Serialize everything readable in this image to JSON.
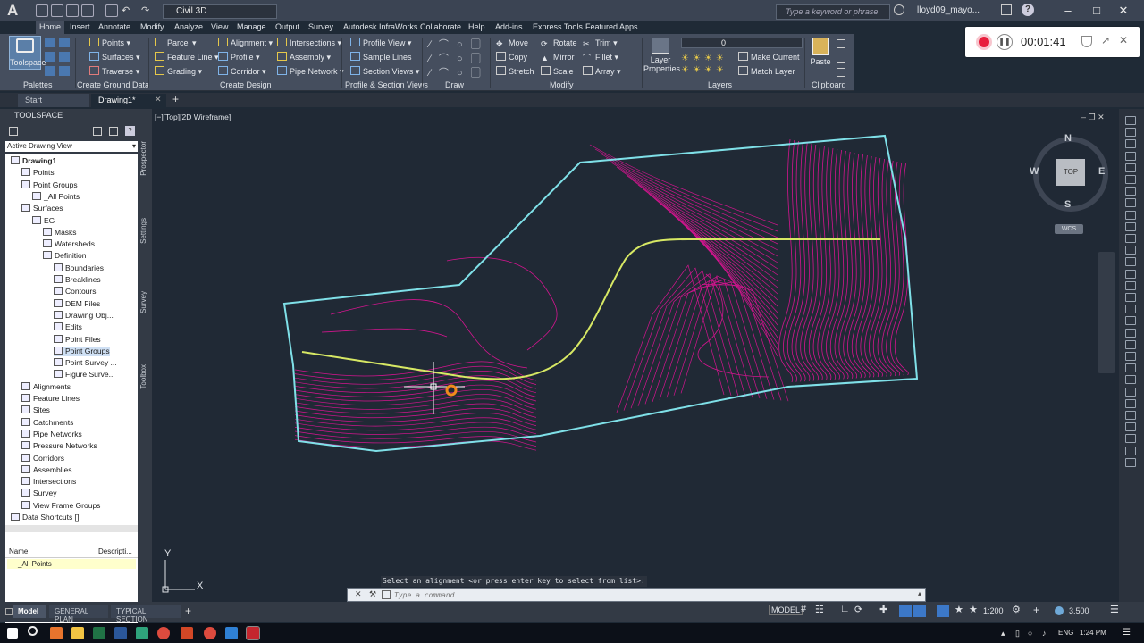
{
  "app": {
    "logo_letter": "A",
    "workspace": "Civil 3D",
    "search_placeholder": "Type a keyword or phrase",
    "user": "lloyd09_mayo...",
    "help": "?"
  },
  "ribbon_tabs": [
    "Home",
    "Insert",
    "Annotate",
    "Modify",
    "Analyze",
    "View",
    "Manage",
    "Output",
    "Survey",
    "Autodesk InfraWorks",
    "Collaborate",
    "Help",
    "Add-ins",
    "Express Tools",
    "Featured Apps"
  ],
  "ribbon": {
    "toolspace_label": "Toolspace",
    "palettes_title": "Palettes",
    "ground_data": {
      "title": "Create Ground Data",
      "items": [
        "Points",
        "Surfaces",
        "Traverse"
      ]
    },
    "design": {
      "title": "Create Design",
      "items": [
        "Parcel",
        "Feature Line",
        "Grading",
        "Alignment",
        "Profile",
        "Corridor",
        "Intersections",
        "Assembly",
        "Pipe Network"
      ]
    },
    "profile_section": {
      "title": "Profile & Section Views",
      "items": [
        "Profile View",
        "Sample Lines",
        "Section Views"
      ]
    },
    "draw_title": "Draw",
    "modify": {
      "title": "Modify",
      "items": [
        "Move",
        "Rotate",
        "Trim",
        "Copy",
        "Mirror",
        "Fillet",
        "Stretch",
        "Scale",
        "Array"
      ]
    },
    "layers": {
      "title": "Layers",
      "layer_props": "Layer Properties",
      "current_layer": "0",
      "make_current": "Make Current",
      "match_layer": "Match Layer"
    },
    "clipboard": {
      "title": "Clipboard",
      "paste": "Paste"
    }
  },
  "recording": {
    "time": "00:01:41"
  },
  "file_tabs": [
    "Start",
    "Drawing1*"
  ],
  "toolspace": {
    "header": "TOOLSPACE",
    "view": "Active Drawing View",
    "tree": [
      {
        "label": "Drawing1",
        "level": 0,
        "bold": true
      },
      {
        "label": "Points",
        "level": 1
      },
      {
        "label": "Point Groups",
        "level": 1
      },
      {
        "label": "_All Points",
        "level": 2
      },
      {
        "label": "Surfaces",
        "level": 1
      },
      {
        "label": "EG",
        "level": 2
      },
      {
        "label": "Masks",
        "level": 3
      },
      {
        "label": "Watersheds",
        "level": 3
      },
      {
        "label": "Definition",
        "level": 3
      },
      {
        "label": "Boundaries",
        "level": 4
      },
      {
        "label": "Breaklines",
        "level": 4
      },
      {
        "label": "Contours",
        "level": 4
      },
      {
        "label": "DEM Files",
        "level": 4
      },
      {
        "label": "Drawing Obj...",
        "level": 4
      },
      {
        "label": "Edits",
        "level": 4
      },
      {
        "label": "Point Files",
        "level": 4
      },
      {
        "label": "Point Groups",
        "level": 4,
        "selected": true
      },
      {
        "label": "Point Survey ...",
        "level": 4
      },
      {
        "label": "Figure Surve...",
        "level": 4
      },
      {
        "label": "Alignments",
        "level": 1
      },
      {
        "label": "Feature Lines",
        "level": 1
      },
      {
        "label": "Sites",
        "level": 1
      },
      {
        "label": "Catchments",
        "level": 1
      },
      {
        "label": "Pipe Networks",
        "level": 1
      },
      {
        "label": "Pressure Networks",
        "level": 1
      },
      {
        "label": "Corridors",
        "level": 1
      },
      {
        "label": "Assemblies",
        "level": 1
      },
      {
        "label": "Intersections",
        "level": 1
      },
      {
        "label": "Survey",
        "level": 1
      },
      {
        "label": "View Frame Groups",
        "level": 1
      },
      {
        "label": "Data Shortcuts []",
        "level": 0
      }
    ],
    "side_tabs": [
      "Prospector",
      "Settings",
      "Survey",
      "Toolbox"
    ],
    "props": {
      "col_name": "Name",
      "col_desc": "Descripti...",
      "row": "_All Points"
    }
  },
  "viewport": {
    "label": "[−][Top][2D Wireframe]",
    "viewcube": {
      "top": "TOP",
      "n": "N",
      "s": "S",
      "e": "E",
      "w": "W",
      "wcs": "WCS"
    },
    "ucs_x": "X",
    "ucs_y": "Y",
    "colors": {
      "boundary": "#7fe0e8",
      "contours": "#d3158f",
      "alignment": "#d7e864"
    }
  },
  "command": {
    "prompt": "Select an alignment <or press enter key to select from list>:",
    "placeholder": "Type a command"
  },
  "layout_tabs": [
    "Model",
    "GENERAL PLAN",
    "TYPICAL SECTION"
  ],
  "status": {
    "model": "MODEL",
    "scale": "1:200",
    "value": "3.500"
  },
  "taskbar": {
    "lang": "ENG",
    "time": "1:24 PM"
  }
}
